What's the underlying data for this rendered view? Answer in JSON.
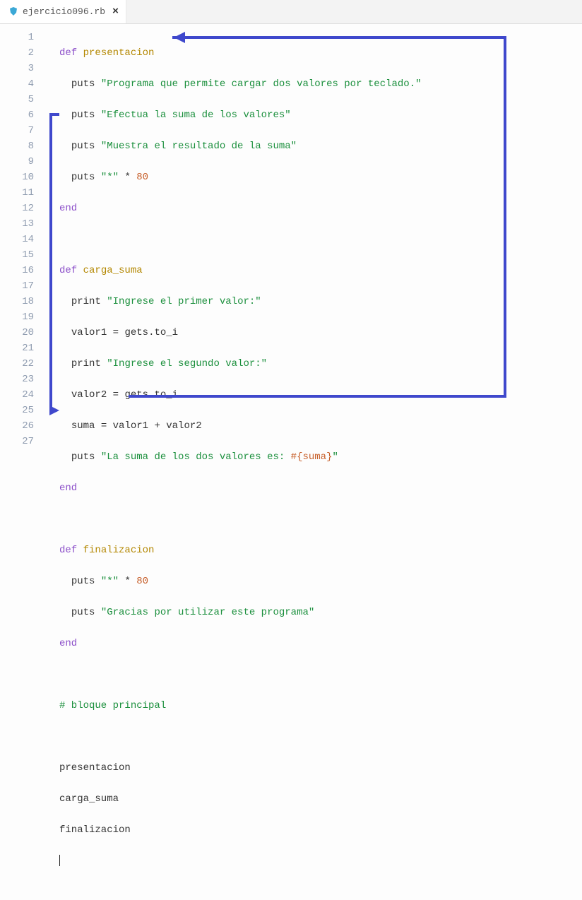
{
  "tab": {
    "filename": "ejercicio096.rb"
  },
  "gutter": {
    "lines": 27
  },
  "code": {
    "l1_def": "def",
    "l1_name": "presentacion",
    "l2_puts": "puts",
    "l2_str": "\"Programa que permite cargar dos valores por teclado.\"",
    "l3_puts": "puts",
    "l3_str": "\"Efectua la suma de los valores\"",
    "l4_puts": "puts",
    "l4_str": "\"Muestra el resultado de la suma\"",
    "l5_puts": "puts",
    "l5_str": "\"*\"",
    "l5_op": "*",
    "l5_num": "80",
    "l6_end": "end",
    "l8_def": "def",
    "l8_name": "carga_suma",
    "l9_print": "print",
    "l9_str": "\"Ingrese el primer valor:\"",
    "l10_var": "valor1",
    "l10_eq": "=",
    "l10_gets": "gets",
    "l10_dot": ".",
    "l10_toi": "to_i",
    "l11_print": "print",
    "l11_str": "\"Ingrese el segundo valor:\"",
    "l12_var": "valor2",
    "l12_eq": "=",
    "l12_gets": "gets",
    "l12_dot": ".",
    "l12_toi": "to_i",
    "l13_suma": "suma",
    "l13_eq": "=",
    "l13_rhs": "valor1 + valor2",
    "l14_puts": "puts",
    "l14_str1": "\"La suma de los dos valores es: ",
    "l14_interp": "#{suma}",
    "l14_str2": "\"",
    "l15_end": "end",
    "l17_def": "def",
    "l17_name": "finalizacion",
    "l18_puts": "puts",
    "l18_str": "\"*\"",
    "l18_op": "*",
    "l18_num": "80",
    "l19_puts": "puts",
    "l19_str": "\"Gracias por utilizar este programa\"",
    "l20_end": "end",
    "l22_cm": "# bloque principal",
    "l24": "presentacion",
    "l25": "carga_suma",
    "l26": "finalizacion"
  }
}
